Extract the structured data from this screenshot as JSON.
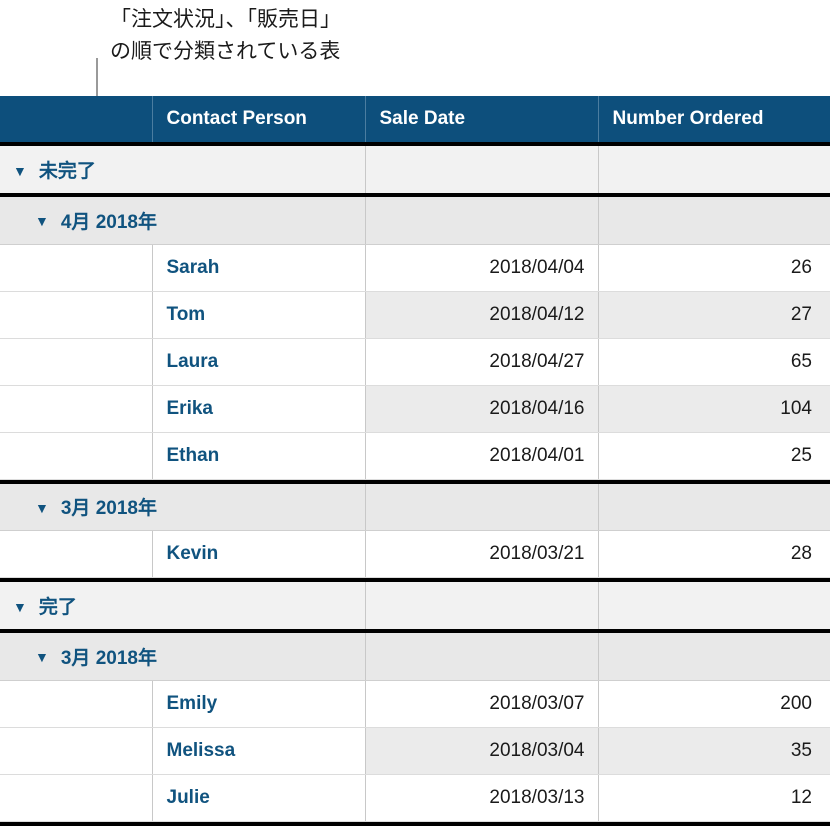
{
  "callout": {
    "text": "「注文状況」、「販売日」\nの順で分類されている表",
    "line_color": "#9a9a9a"
  },
  "colors": {
    "header_bg": "#0d4f7c",
    "header_text": "#ffffff",
    "accent_blue": "#10537f",
    "group1_bg": "#f2f2f2",
    "group2_bg": "#e8e8e8",
    "row_alt_bg": "#ebebeb",
    "separator": "#000000"
  },
  "table": {
    "columns": [
      {
        "key": "blank",
        "label": "",
        "align": "left"
      },
      {
        "key": "contact_person",
        "label": "Contact Person",
        "align": "left"
      },
      {
        "key": "sale_date",
        "label": "Sale Date",
        "align": "right"
      },
      {
        "key": "number_ordered",
        "label": "Number Ordered",
        "align": "right"
      }
    ],
    "disclosure_icon": "▼",
    "groups": [
      {
        "label": "未完了",
        "level": 1,
        "subgroups": [
          {
            "label": "4月 2018年",
            "level": 2,
            "rows": [
              {
                "contact_person": "Sarah",
                "sale_date": "2018/04/04",
                "number_ordered": "26"
              },
              {
                "contact_person": "Tom",
                "sale_date": "2018/04/12",
                "number_ordered": "27"
              },
              {
                "contact_person": "Laura",
                "sale_date": "2018/04/27",
                "number_ordered": "65"
              },
              {
                "contact_person": "Erika",
                "sale_date": "2018/04/16",
                "number_ordered": "104"
              },
              {
                "contact_person": "Ethan",
                "sale_date": "2018/04/01",
                "number_ordered": "25"
              }
            ]
          },
          {
            "label": "3月 2018年",
            "level": 2,
            "rows": [
              {
                "contact_person": "Kevin",
                "sale_date": "2018/03/21",
                "number_ordered": "28"
              }
            ]
          }
        ]
      },
      {
        "label": "完了",
        "level": 1,
        "subgroups": [
          {
            "label": "3月 2018年",
            "level": 2,
            "rows": [
              {
                "contact_person": "Emily",
                "sale_date": "2018/03/07",
                "number_ordered": "200"
              },
              {
                "contact_person": "Melissa",
                "sale_date": "2018/03/04",
                "number_ordered": "35"
              },
              {
                "contact_person": "Julie",
                "sale_date": "2018/03/13",
                "number_ordered": "12"
              }
            ]
          }
        ]
      }
    ]
  }
}
